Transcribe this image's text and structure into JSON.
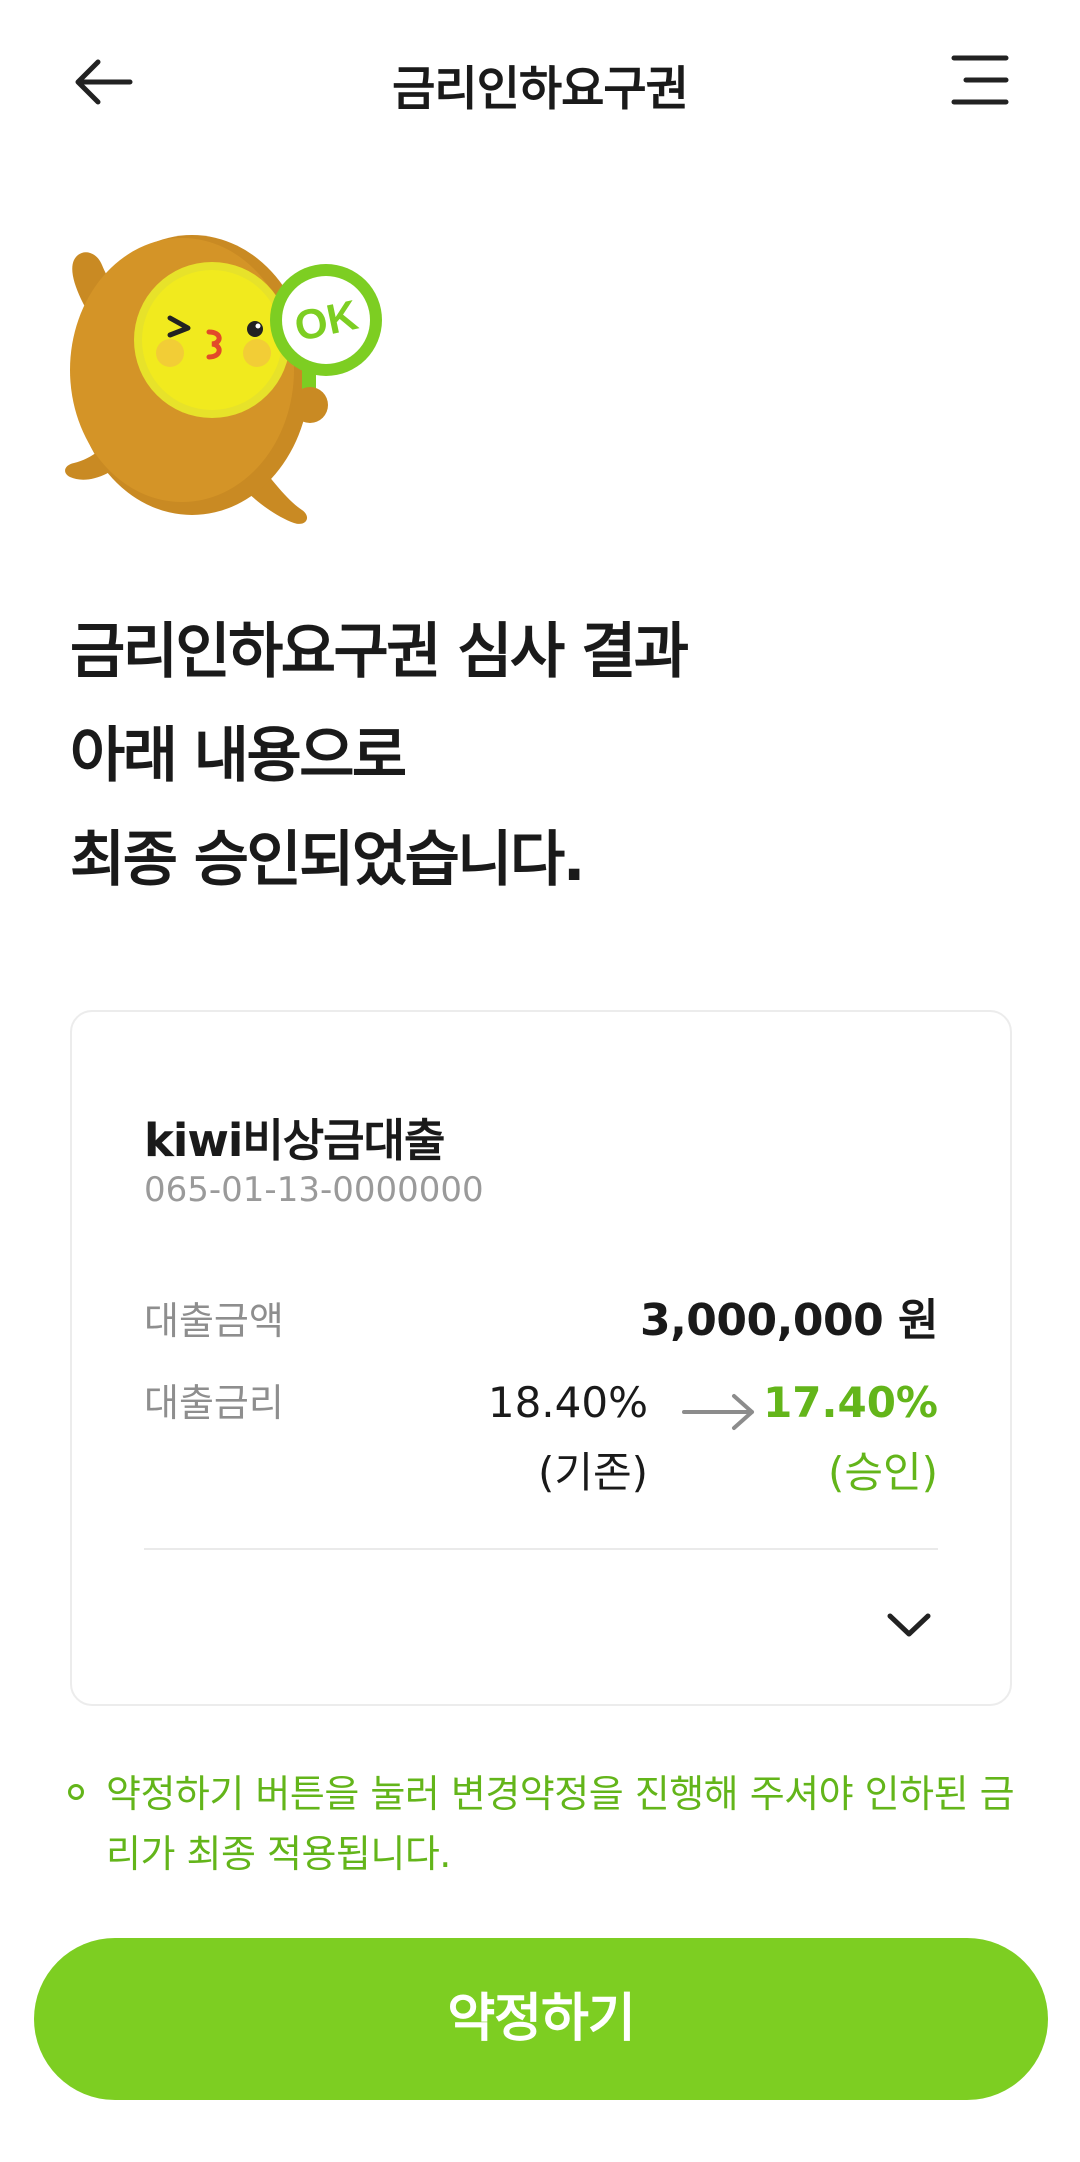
{
  "header": {
    "title": "금리인하요구권",
    "back_icon": "arrow-left-icon",
    "menu_icon": "menu-icon"
  },
  "mascot": {
    "sign_text": "OK"
  },
  "headline": {
    "line1": "금리인하요구권 심사 결과",
    "line2": "아래 내용으로",
    "line3_prefix": "최종 ",
    "line3_highlight": "승인",
    "line3_suffix": "되었습니다."
  },
  "card": {
    "product_name": "kiwi비상금대출",
    "account_number": "065-01-13-0000000",
    "loan_amount_label": "대출금액",
    "loan_amount_value": "3,000,000 원",
    "loan_rate_label": "대출금리",
    "old_rate": "18.40%",
    "old_rate_sub": "(기존)",
    "new_rate": "17.40%",
    "new_rate_sub": "(승인)",
    "expand_icon": "chevron-down-icon"
  },
  "notice": {
    "text": "약정하기 버튼을 눌러 변경약정을 진행해 주셔야 인하된 금리가 최종 적용됩니다."
  },
  "cta": {
    "label": "약정하기"
  },
  "colors": {
    "accent_green": "#7dce22",
    "text_green": "#63b51a",
    "highlight_green": "#d5efb6"
  }
}
